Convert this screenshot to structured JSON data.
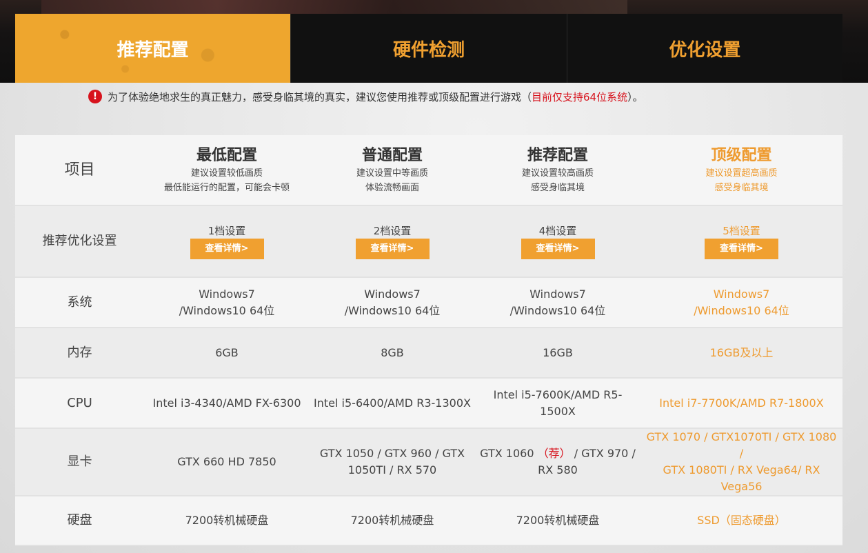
{
  "tabs": [
    {
      "label": "推荐配置",
      "active": true
    },
    {
      "label": "硬件检测",
      "active": false
    },
    {
      "label": "优化设置",
      "active": false
    }
  ],
  "notice": {
    "icon": "alert-icon",
    "text_before": "为了体验绝地求生的真正魅力，感受身临其境的真实，建议您使用推荐或顶级配置进行游戏（",
    "highlight": "目前仅支持64位系统",
    "text_after": "）。"
  },
  "table": {
    "header": {
      "item_label": "项目",
      "columns": [
        {
          "title": "最低配置",
          "sub1": "建议设置较低画质",
          "sub2": "最低能运行的配置，可能会卡顿"
        },
        {
          "title": "普通配置",
          "sub1": "建议设置中等画质",
          "sub2": "体验流畅画面"
        },
        {
          "title": "推荐配置",
          "sub1": "建议设置较高画质",
          "sub2": "感受身临其境"
        },
        {
          "title": "顶级配置",
          "sub1": "建议设置超高画质",
          "sub2": "感受身临其境"
        }
      ]
    },
    "optimize": {
      "label": "推荐优化设置",
      "button_label": "查看详情>",
      "levels": [
        "1档设置",
        "2档设置",
        "4档设置",
        "5档设置"
      ]
    },
    "os": {
      "label": "系统",
      "values": [
        {
          "line1": "Windows7",
          "line2": "/Windows10 64位"
        },
        {
          "line1": "Windows7",
          "line2": "/Windows10 64位"
        },
        {
          "line1": "Windows7",
          "line2": "/Windows10 64位"
        },
        {
          "line1": "Windows7",
          "line2": "/Windows10 64位"
        }
      ]
    },
    "memory": {
      "label": "内存",
      "values": [
        "6GB",
        "8GB",
        "16GB",
        "16GB及以上"
      ]
    },
    "cpu": {
      "label": "CPU",
      "values": [
        "Intel i3-4340/AMD FX-6300",
        "Intel i5-6400/AMD R3-1300X",
        "Intel i5-7600K/AMD R5-1500X",
        "Intel i7-7700K/AMD R7-1800X"
      ]
    },
    "gpu": {
      "label": "显卡",
      "min": "GTX 660 HD 7850",
      "normal_line1": "GTX 1050 / GTX 960 / GTX",
      "normal_line2": "1050TI / RX 570",
      "rec_prefix": "GTX 1060 ",
      "rec_tag": "（荐）",
      "rec_suffix": " / GTX 970 /",
      "rec_line2": "RX 580",
      "top_line1": "GTX 1070 / GTX1070TI / GTX 1080 /",
      "top_line2": "GTX 1080TI / RX Vega64/ RX Vega56"
    },
    "disk": {
      "label": "硬盘",
      "values": [
        "7200转机械硬盘",
        "7200转机械硬盘",
        "7200转机械硬盘",
        "SSD（固态硬盘）"
      ]
    }
  },
  "colors": {
    "accent": "#f0a030",
    "alert": "#d7131d",
    "dark": "#111111"
  }
}
